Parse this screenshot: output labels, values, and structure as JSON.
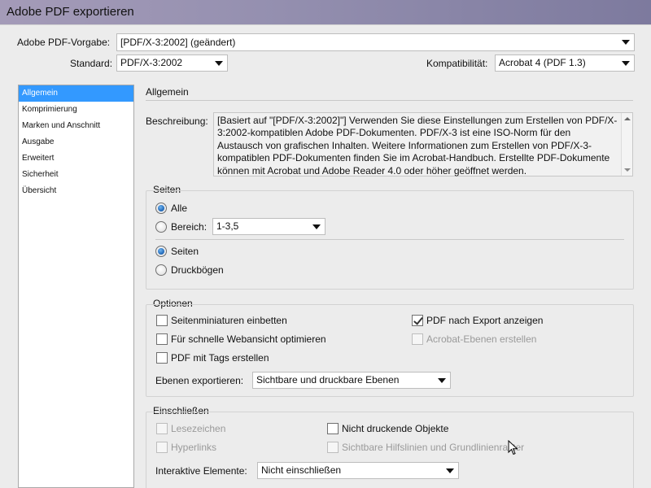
{
  "window": {
    "title": "Adobe PDF exportieren"
  },
  "header": {
    "preset_label": "Adobe PDF-Vorgabe:",
    "preset_value": "[PDF/X-3:2002] (geändert)",
    "standard_label": "Standard:",
    "standard_value": "PDF/X-3:2002",
    "compat_label": "Kompatibilität:",
    "compat_value": "Acrobat 4 (PDF 1.3)"
  },
  "sidebar": {
    "items": [
      {
        "label": "Allgemein",
        "active": true
      },
      {
        "label": "Komprimierung"
      },
      {
        "label": "Marken und Anschnitt"
      },
      {
        "label": "Ausgabe"
      },
      {
        "label": "Erweitert"
      },
      {
        "label": "Sicherheit"
      },
      {
        "label": "Übersicht"
      }
    ]
  },
  "main": {
    "section_title": "Allgemein",
    "description_label": "Beschreibung:",
    "description_text": "[Basiert auf \"[PDF/X-3:2002]\"] Verwenden Sie diese Einstellungen zum Erstellen von PDF/X-3:2002-kompatiblen Adobe PDF-Dokumenten. PDF/X-3 ist eine ISO-Norm für den Austausch von grafischen Inhalten. Weitere Informationen zum Erstellen von PDF/X-3-kompatiblen PDF-Dokumenten finden Sie im Acrobat-Handbuch. Erstellte PDF-Dokumente können mit Acrobat und Adobe Reader 4.0 oder höher geöffnet werden.",
    "pages": {
      "title": "Seiten",
      "all_label": "Alle",
      "range_label": "Bereich:",
      "range_value": "1-3,5",
      "pages_label": "Seiten",
      "spreads_label": "Druckbögen"
    },
    "options": {
      "title": "Optionen",
      "embed_thumbnails": "Seitenminiaturen einbetten",
      "fast_web": "Für schnelle Webansicht optimieren",
      "tagged_pdf": "PDF mit Tags erstellen",
      "view_after_export": "PDF nach Export anzeigen",
      "acrobat_layers": "Acrobat-Ebenen erstellen",
      "export_layers_label": "Ebenen exportieren:",
      "export_layers_value": "Sichtbare und druckbare Ebenen"
    },
    "include": {
      "title": "Einschließen",
      "bookmarks": "Lesezeichen",
      "hyperlinks": "Hyperlinks",
      "nonprinting": "Nicht druckende Objekte",
      "guides": "Sichtbare Hilfslinien und Grundlinienraster",
      "interactive_label": "Interaktive Elemente:",
      "interactive_value": "Nicht einschließen"
    }
  }
}
